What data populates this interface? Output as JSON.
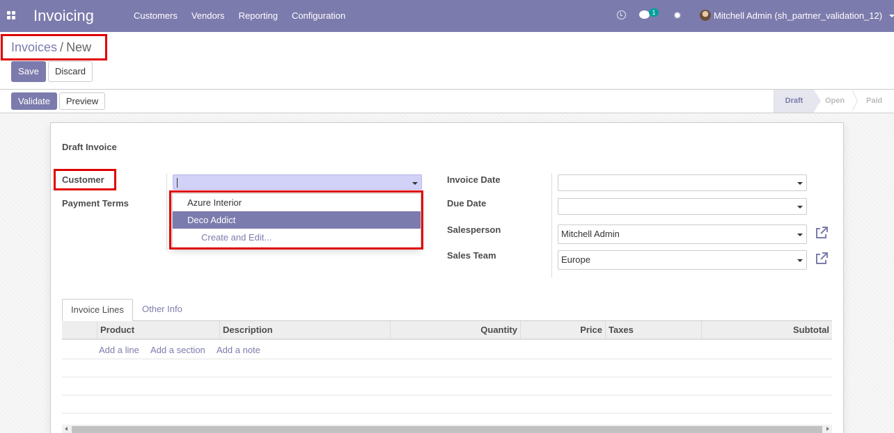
{
  "app": {
    "title": "Invoicing",
    "menu": [
      "Customers",
      "Vendors",
      "Reporting",
      "Configuration"
    ],
    "chat_badge": "1",
    "user": "Mitchell Admin (sh_partner_validation_12)"
  },
  "breadcrumb": {
    "parent": "Invoices",
    "separator": "/",
    "current": "New"
  },
  "buttons": {
    "save": "Save",
    "discard": "Discard",
    "validate": "Validate",
    "preview": "Preview"
  },
  "status": {
    "stages": [
      "Draft",
      "Open",
      "Paid"
    ],
    "current": "Draft"
  },
  "form": {
    "heading": "Draft Invoice",
    "customer_label": "Customer",
    "customer_value": "",
    "payment_terms_label": "Payment Terms",
    "invoice_date_label": "Invoice Date",
    "invoice_date_value": "",
    "due_date_label": "Due Date",
    "due_date_value": "",
    "salesperson_label": "Salesperson",
    "salesperson_value": "Mitchell Admin",
    "sales_team_label": "Sales Team",
    "sales_team_value": "Europe"
  },
  "dropdown": {
    "items": [
      "Azure Interior",
      "Deco Addict"
    ],
    "active_item": "Deco Addict",
    "create_label": "Create and Edit..."
  },
  "tabs": [
    "Invoice Lines",
    "Other Info"
  ],
  "table": {
    "columns": [
      "Product",
      "Description",
      "Quantity",
      "Price",
      "Taxes",
      "Subtotal"
    ],
    "add_links": [
      "Add a line",
      "Add a section",
      "Add a note"
    ]
  },
  "colors": {
    "brand": "#7c7bad",
    "highlight": "#e00000",
    "focus": "#d2d1f8"
  }
}
